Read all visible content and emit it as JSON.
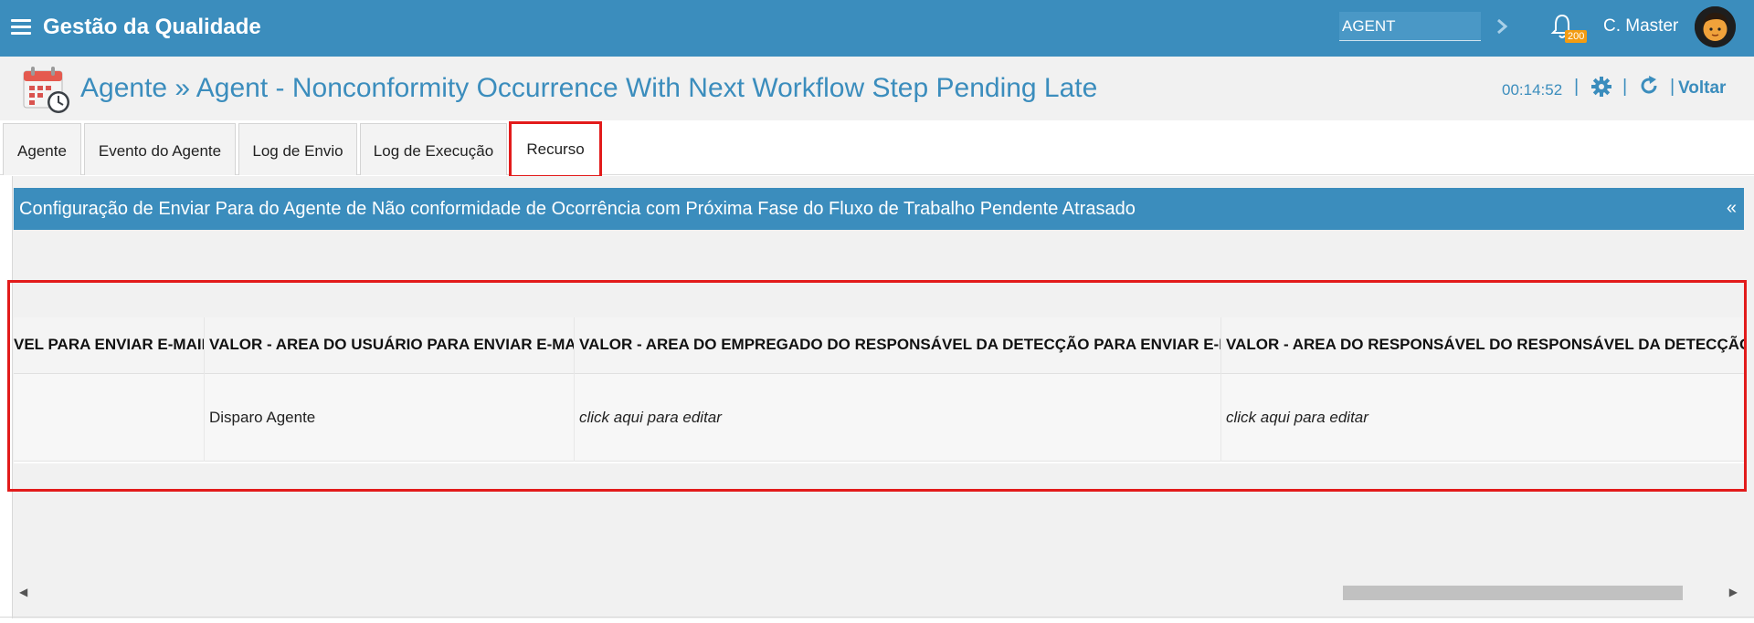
{
  "header": {
    "app_title": "Gestão da Qualidade",
    "search_value": "AGENT",
    "notification_count": "200",
    "user_name": "C. Master"
  },
  "subheader": {
    "title": "Agente » Agent - Nonconformity Occurrence With Next Workflow Step Pending Late",
    "timer": "00:14:52",
    "separator": "|",
    "back_label": "Voltar"
  },
  "tabs": [
    {
      "label": "Agente"
    },
    {
      "label": "Evento do Agente"
    },
    {
      "label": "Log de Envio"
    },
    {
      "label": "Log de Execução"
    },
    {
      "label": "Recurso",
      "active": true
    }
  ],
  "panel": {
    "title": "Configuração de Enviar Para do Agente de Não conformidade de Ocorrência com Próxima Fase do Fluxo de Trabalho Pendente Atrasado",
    "collapse_icon": "«"
  },
  "grid": {
    "columns": [
      "VEL PARA ENVIAR E-MAIL",
      "VALOR - AREA DO USUÁRIO PARA ENVIAR E-MAIL",
      "VALOR - AREA DO EMPREGADO DO RESPONSÁVEL DA DETECÇÃO PARA ENVIAR E-MAIL",
      "VALOR - AREA DO RESPONSÁVEL DO RESPONSÁVEL DA DETECÇÃO PARA ENVIAR E-MAIL"
    ],
    "rows": [
      [
        "",
        "Disparo Agente",
        "click aqui para editar",
        "click aqui para editar"
      ]
    ]
  },
  "colors": {
    "brand": "#3b8dbd",
    "highlight": "#e21b1b",
    "badge": "#f39c12"
  }
}
